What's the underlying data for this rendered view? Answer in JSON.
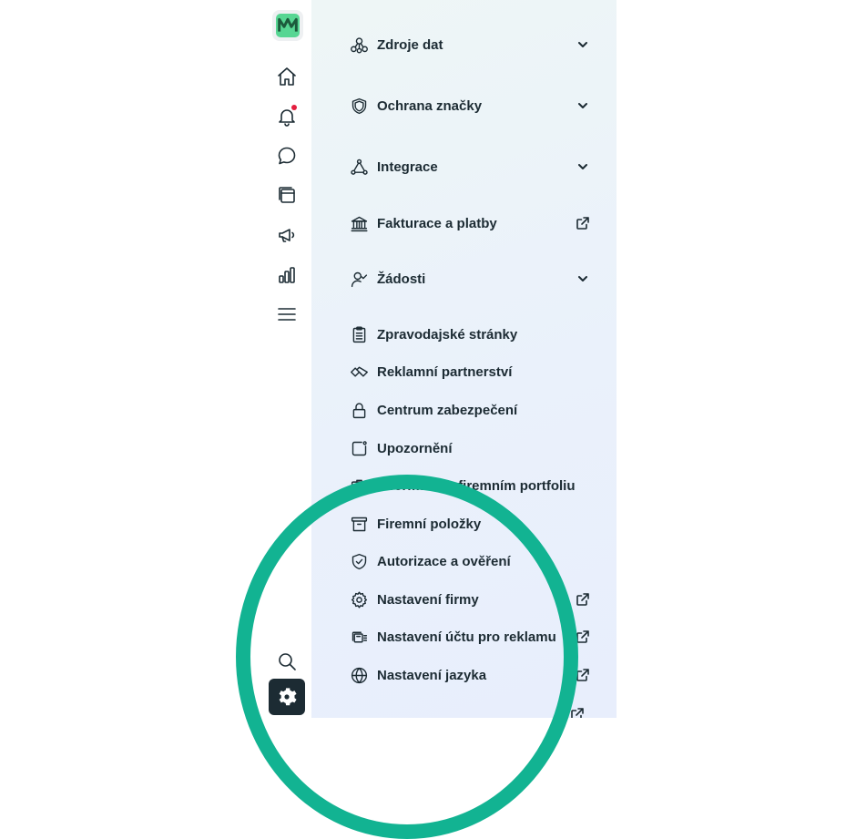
{
  "rail": {
    "icons": [
      "app-logo-icon",
      "home-icon",
      "notifications-icon",
      "messages-icon",
      "content-icon",
      "ads-megaphone-icon",
      "insights-icon",
      "menu-icon",
      "search-icon",
      "settings-gear-icon"
    ],
    "notification_dot_color": "#e41e3f",
    "active_color": "#1c2b33",
    "logo_color": "#57d693"
  },
  "menu": {
    "items": [
      {
        "label": "Zdroje dat",
        "icon": "data-sources-icon",
        "trail": "chevron-down"
      },
      {
        "label": "Ochrana značky",
        "icon": "shield-icon",
        "trail": "chevron-down"
      },
      {
        "label": "Integrace",
        "icon": "integration-icon",
        "trail": "chevron-down"
      },
      {
        "label": "Fakturace a platby",
        "icon": "bank-icon",
        "trail": "external-link"
      },
      {
        "label": "Žádosti",
        "icon": "person-check-icon",
        "trail": "chevron-down"
      },
      {
        "label": "Zpravodajské stránky",
        "icon": "clipboard-icon",
        "trail": ""
      },
      {
        "label": "Reklamní partnerství",
        "icon": "handshake-icon",
        "trail": ""
      },
      {
        "label": "Centrum zabezpečení",
        "icon": "lock-icon",
        "trail": ""
      },
      {
        "label": "Upozornění",
        "icon": "notification-square-icon",
        "trail": ""
      },
      {
        "label": "Informace o firemním portfoliu",
        "icon": "portfolio-icon",
        "trail": ""
      },
      {
        "label": "Firemní položky",
        "icon": "archive-box-icon",
        "trail": ""
      },
      {
        "label": "Autorizace a ověření",
        "icon": "shield-check-icon",
        "trail": ""
      },
      {
        "label": "Nastavení firmy",
        "icon": "gear-icon",
        "trail": "external-link"
      },
      {
        "label": "Nastavení účtu pro reklamu",
        "icon": "ad-account-icon",
        "trail": "external-link"
      },
      {
        "label": "Nastavení jazyka",
        "icon": "globe-icon",
        "trail": "external-link"
      }
    ]
  },
  "overlay": {
    "color": "#12b392"
  }
}
